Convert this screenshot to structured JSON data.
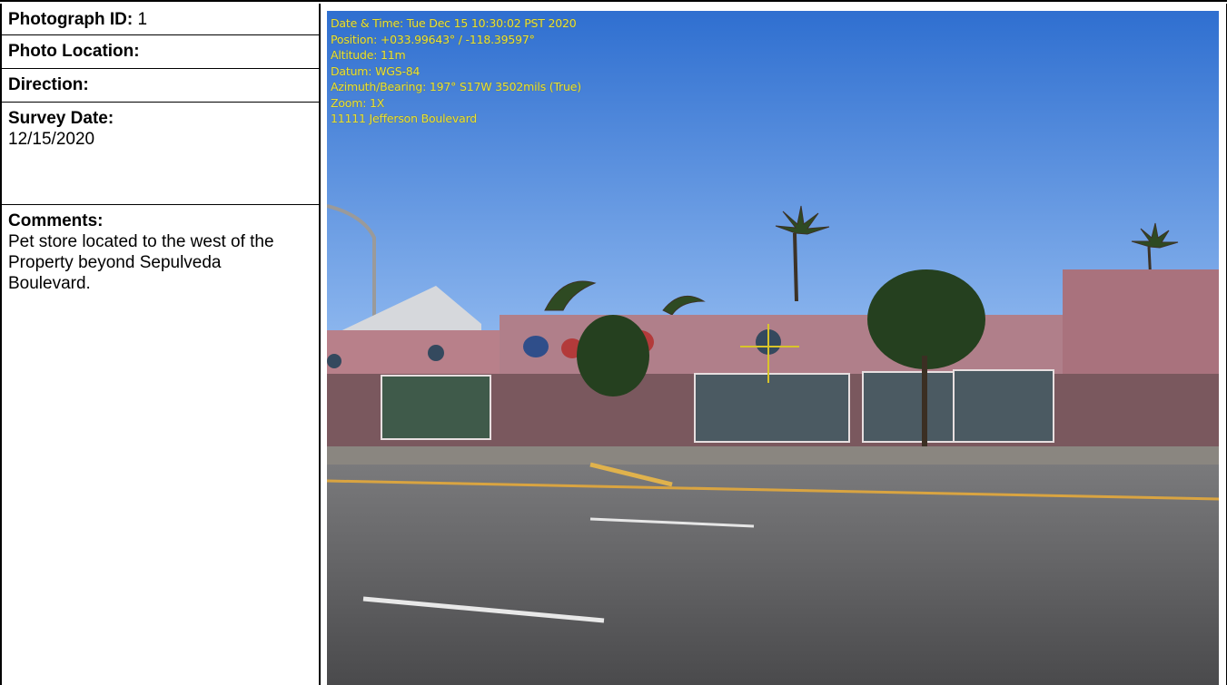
{
  "fields": {
    "photograph_id": {
      "label": "Photograph ID:",
      "value": "1"
    },
    "photo_location": {
      "label": "Photo Location:",
      "value": ""
    },
    "direction": {
      "label": "Direction:",
      "value": ""
    },
    "survey_date": {
      "label": "Survey Date:",
      "value": "12/15/2020"
    },
    "comments": {
      "label": "Comments:",
      "value": "Pet store located to the west of the Property beyond Sepulveda Boulevard."
    }
  },
  "photo": {
    "overlay_lines": [
      "Date & Time: Tue Dec 15 10:30:02 PST 2020",
      "Position: +033.99643° / -118.39597°",
      "Altitude: 11m",
      "Datum: WGS-84",
      "Azimuth/Bearing: 197° S17W 3502mils (True)",
      "Zoom: 1X",
      "11111 Jefferson Boulevard"
    ],
    "overlay_color": "#e8e23a",
    "sky_color": "#3f7fd6",
    "road_color": "#5b5b5d",
    "building_color": "#b8808a"
  }
}
